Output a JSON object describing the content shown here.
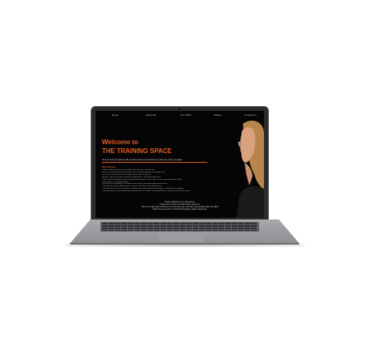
{
  "nav": {
    "items": [
      "Home",
      "About Me",
      "Our Plans",
      "Gallery",
      "Contact Us"
    ]
  },
  "hero": {
    "line1": "Welcome to",
    "line2": "THE TRAINING SPACE",
    "tagline": "Here you will go anywhere with a positive focus you consistency to help you reach your goals",
    "accent_color": "#e85a20"
  },
  "journey": {
    "title": "My Journey",
    "lines": [
      "I used to weigh no one with my health, was 'Gym you' all about diet,",
      "there was the type who was beautiful and ate 'healthy' without even trying it until",
      "As a teen I learned how to lose weight and it wasn't easy at all.",
      "At times I did try I learned a lot about healthy fitness - diet and activity time.",
      "Then I started learning and then finally got a good fitness coach, which is the help that gave me today.",
      "I really love it - for I was not alone.",
      "Next to me my campaigns is the person you need for the information you look after.",
      "I can help you choose food choices, fit choices and trust to the right direction.",
      "You aren't tied to a strict meal plan, I'll dedicate the right nutrition and training, I'll do my best to help you.",
      "If you'll get to plan to get started with any difficulties, If needed I can help you but I'll help you achieve your goals."
    ]
  },
  "footer": {
    "lines": [
      "I know I will work on my own journey.",
      "Thank you so much, and I hope I'll see you soon.",
      "There is no easy way to achieve it, so never give up, if you have any question about the plans",
      "I hope I'll see you soon. On My Training Space, please contact me."
    ]
  }
}
